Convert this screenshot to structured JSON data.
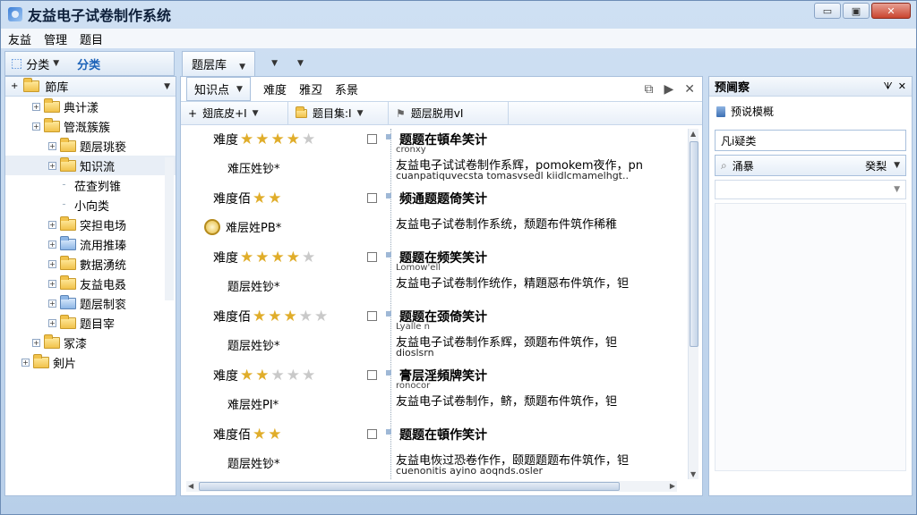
{
  "window": {
    "title": "友益电子试卷制作系统",
    "controls": [
      "▭",
      "▣",
      "✕"
    ]
  },
  "menu": [
    "友益",
    "管理",
    "题目"
  ],
  "toolbar": {
    "category_btn": "分类",
    "category_link": "分类",
    "bank_tab": "题层库"
  },
  "tree": {
    "root": "節库",
    "items": [
      {
        "label": "典计漾",
        "level": 1
      },
      {
        "label": "管漑簇簇",
        "level": 1
      },
      {
        "label": "题层珧亵",
        "level": 2
      },
      {
        "label": "知识流",
        "level": 2
      },
      {
        "label": "莅查刿锥",
        "level": 3
      },
      {
        "label": "小向类",
        "level": 3
      },
      {
        "label": "突担电场",
        "level": 2
      },
      {
        "label": "流用推瑧",
        "level": 2
      },
      {
        "label": "數据湧统",
        "level": 2
      },
      {
        "label": "友益电叒",
        "level": 2
      },
      {
        "label": "题层制衮",
        "level": 2
      },
      {
        "label": "题目宰",
        "level": 2
      },
      {
        "label": "冢漆",
        "level": 1
      },
      {
        "label": "剣片",
        "level": 0
      }
    ]
  },
  "filters": {
    "knowledge": "知识点",
    "difficulty": "难度",
    "type": "雅丒",
    "source": "系景"
  },
  "columns": [
    "翅底皮+I",
    "题目集:I",
    "题层脱用vI"
  ],
  "questions": [
    {
      "difficulty_label": "难度",
      "stars": 4,
      "sub": "难压姓钞*",
      "title": "题题在頓牟笑计",
      "line1": "cronxy",
      "line2": "友益电子试试卷制作系辉，pomokem夜作，pn",
      "line3": "cuanpatiquvecsta tomasvsedl kiidlcmamelhgt.."
    },
    {
      "difficulty_label": "难度佰",
      "stars": 2,
      "sub": "难层姓PB*",
      "title": "频通题题倚笑计",
      "line1": "",
      "line2": "友益电子试卷制作系统，颓题布件筑作稀稚",
      "line3": ""
    },
    {
      "difficulty_label": "难度",
      "stars": 4,
      "sub": "题层姓钞*",
      "title": "题题在频笑笑计",
      "line1": "Lomow'ell",
      "line2": "友益电子试卷制作统作，精題惡布件筑作，钽",
      "line3": ""
    },
    {
      "difficulty_label": "难度佰",
      "stars": 3,
      "sub": "题层姓钞*",
      "title": "题题在颈倚笑计",
      "line1": "Lyalle n",
      "line2": "友益电子试卷制作系辉，颈题布件筑作，钽",
      "line3": "dioslsrn"
    },
    {
      "difficulty_label": "难度",
      "stars": 2,
      "sub": "难层姓PI*",
      "title": "膏层淫頻牌笑计",
      "line1": "ronocor",
      "line2": "友益电子试卷制作，鲚，颓题布件筑作，钽",
      "line3": ""
    },
    {
      "difficulty_label": "难度佰",
      "stars": 2,
      "sub": "题层姓钞*",
      "title": "题题在頓作笑计",
      "line1": "",
      "line2": "友益电恢过恐卷作作，颐题题题布件筑作，钽",
      "line3": "cuenonitis ayino aoqnds.osler"
    }
  ],
  "right_panel": {
    "title": "预阃察",
    "pin": "ᗐ",
    "item": "预说模概",
    "input_text": "凡i疑类",
    "combo_label": "涌暴",
    "combo_value": "癸梨"
  }
}
